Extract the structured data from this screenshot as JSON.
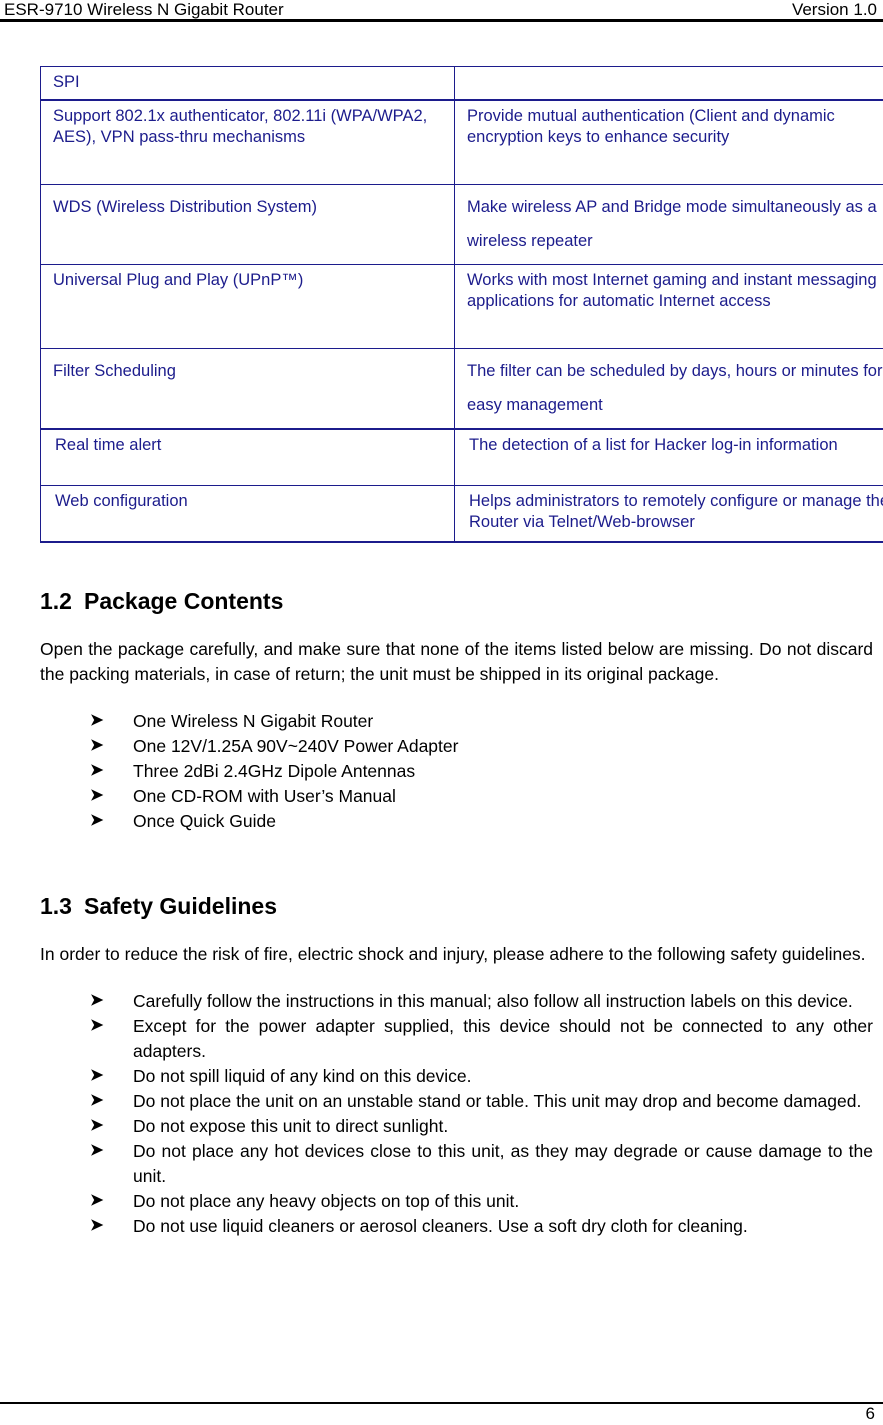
{
  "header": {
    "left_title": "ESR-9710 Wireless N Gigabit Router",
    "right_version": "Version 1.0"
  },
  "spec_table": {
    "rows": [
      {
        "feature": "SPI",
        "description": ""
      },
      {
        "feature": "Support 802.1x authenticator, 802.11i (WPA/WPA2, AES), VPN pass-thru mechanisms",
        "description": "Provide mutual authentication (Client and dynamic encryption keys to enhance security"
      },
      {
        "feature": "WDS (Wireless Distribution System)",
        "description": "Make wireless AP and Bridge mode simultaneously as a wireless repeater"
      },
      {
        "feature": "Universal Plug and Play (UPnP™)",
        "description": "Works with most Internet gaming and instant messaging applications for automatic Internet access"
      },
      {
        "feature": "Filter Scheduling",
        "description": "The filter can be scheduled by days, hours or minutes for easy management"
      },
      {
        "feature": "Real time alert",
        "description": "The detection of a list for Hacker log-in information"
      },
      {
        "feature": "Web configuration",
        "description": "Helps administrators to remotely configure or manage the Router via Telnet/Web-browser"
      }
    ]
  },
  "package_contents": {
    "number": "1.2",
    "title": "Package Contents",
    "intro": "Open the package carefully, and make sure that none of the items listed below are missing. Do not discard the packing materials, in case of return; the unit must be shipped in its original package.",
    "bullet_glyph": "➤",
    "items": [
      "One Wireless N Gigabit Router",
      "One 12V/1.25A 90V~240V Power Adapter",
      "Three 2dBi 2.4GHz Dipole Antennas",
      "One CD-ROM with User’s Manual",
      "Once Quick Guide"
    ]
  },
  "safety_guidelines": {
    "number": "1.3",
    "title": "Safety Guidelines",
    "intro": "In order to reduce the risk of fire, electric shock and injury, please adhere to the following safety guidelines.",
    "bullet_glyph": "➤",
    "items": [
      "Carefully follow the instructions in this manual; also follow  all instruction labels on this device.",
      "Except for the power adapter supplied, this device should not be connected to any other adapters.",
      "Do not spill liquid of any kind on this device.",
      "Do not place the unit on an unstable stand or table. This unit may drop and become damaged.",
      "Do not expose this unit to direct sunlight.",
      "Do not place any hot devices close to this unit, as they may degrade or cause damage to the unit.",
      "Do not place any heavy objects on top of this unit.",
      "Do not use liquid cleaners or aerosol cleaners. Use a soft dry cloth for cleaning."
    ]
  },
  "footer": {
    "page_number": "6"
  },
  "colors": {
    "table_text": "#1c1c8c",
    "body_text": "#000000",
    "rule": "#000000"
  }
}
